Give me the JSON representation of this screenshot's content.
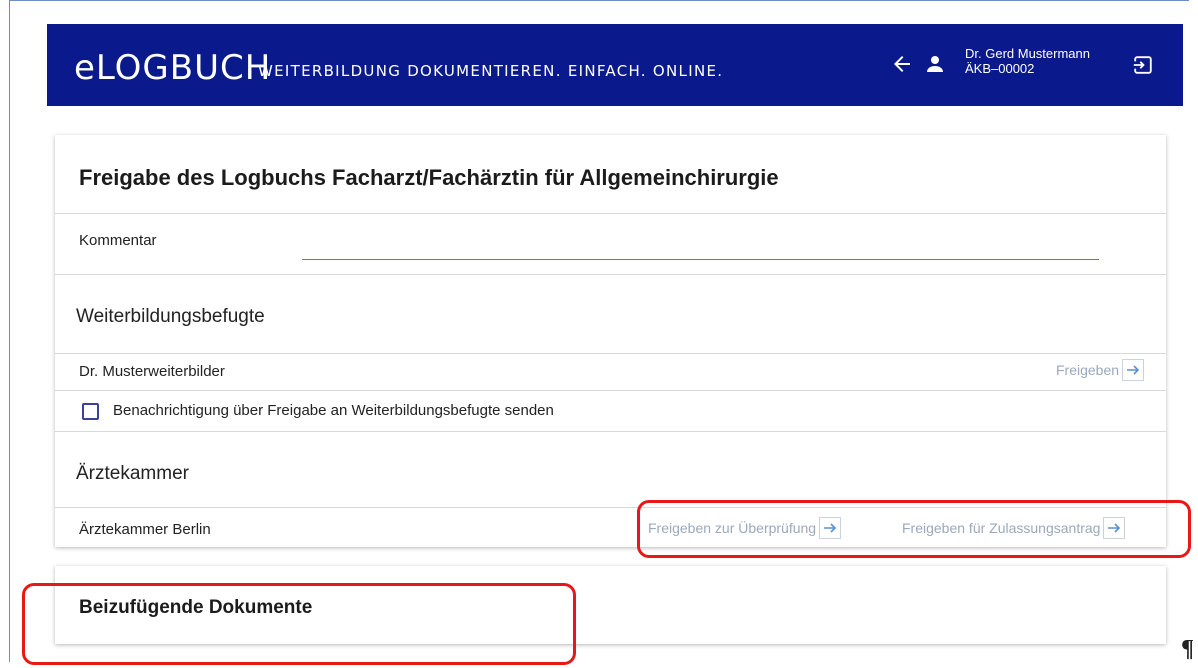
{
  "header": {
    "logo": "eLOGBUCH",
    "tagline": "WEITERBILDUNG DOKUMENTIEREN. EINFACH. ONLINE.",
    "user_name": "Dr. Gerd Mustermann",
    "user_id": "ÄKB–00002",
    "icons": [
      "arrow-left-icon",
      "person-icon",
      "logout-icon"
    ],
    "background_color": "#0a1a8c"
  },
  "release_card": {
    "title": "Freigabe des Logbuchs Facharzt/Fachärztin für Allgemeinchirurgie",
    "comment_label": "Kommentar",
    "comment_value": "",
    "trainers_heading": "Weiterbildungsbefugte",
    "trainer_name": "Dr. Musterweiterbilder",
    "trainer_action": "Freigeben",
    "notify_label": "Benachrichtigung über Freigabe an Weiterbildungsbefugte senden",
    "notify_checked": false,
    "chamber_heading": "Ärztekammer",
    "chamber_name": "Ärztekammer Berlin",
    "chamber_action_review": "Freigeben zur Überprüfung",
    "chamber_action_admission": "Freigeben für Zulassungsantrag"
  },
  "documents_card": {
    "title": "Beizufügende Dokumente"
  },
  "page_mark": "¶",
  "highlight_color": "#e81818"
}
